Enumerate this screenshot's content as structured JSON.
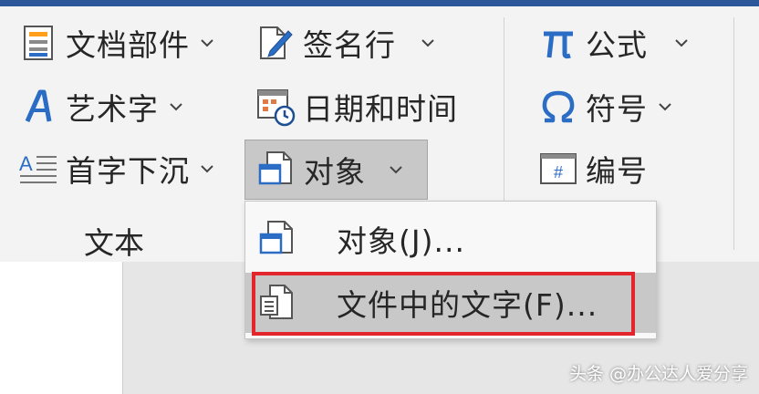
{
  "ribbon": {
    "group_text": {
      "label": "文本",
      "buttons": [
        {
          "label": "文档部件",
          "icon": "document-parts-icon"
        },
        {
          "label": "艺术字",
          "icon": "wordart-icon"
        },
        {
          "label": "首字下沉",
          "icon": "drop-cap-icon"
        },
        {
          "label": "签名行",
          "icon": "signature-line-icon"
        },
        {
          "label": "日期和时间",
          "icon": "date-time-icon"
        },
        {
          "label": "对象",
          "icon": "object-icon",
          "state": "open"
        }
      ]
    },
    "group_symbols": {
      "buttons": [
        {
          "label": "公式",
          "icon": "equation-pi-icon"
        },
        {
          "label": "符号",
          "icon": "symbol-omega-icon"
        },
        {
          "label": "编号",
          "icon": "number-icon",
          "glyph": "#"
        }
      ]
    }
  },
  "dropdown": {
    "items": [
      {
        "label": "对象(J)...",
        "icon": "object-icon"
      },
      {
        "label": "文件中的文字(F)...",
        "icon": "text-from-file-icon",
        "state": "highlighted"
      }
    ]
  },
  "watermark": "头条 @办公达人爱分享",
  "colors": {
    "accent": "#2b579a",
    "highlight": "#e3262b",
    "ribbon_bg": "#f3f3f3",
    "hover_bg": "#c8c8c8"
  }
}
